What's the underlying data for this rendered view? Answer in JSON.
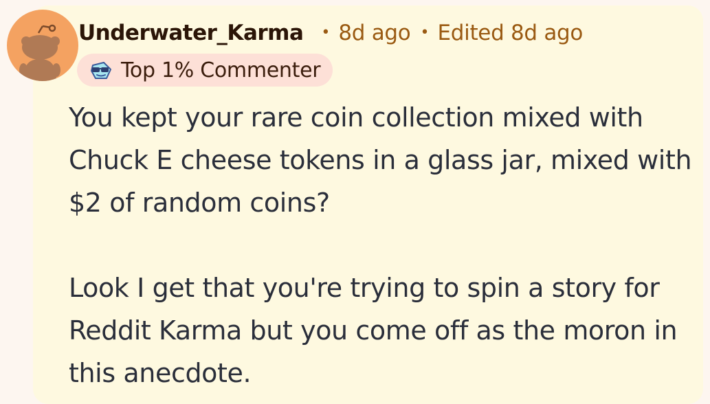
{
  "comment": {
    "author": "Underwater_Karma",
    "separator": "•",
    "posted_time": "8d ago",
    "edited_label": "Edited 8d ago",
    "badge": {
      "icon": "sunglasses-achievement-icon",
      "label": "Top 1% Commenter"
    },
    "paragraphs": [
      "You kept your rare coin collection mixed with Chuck E cheese tokens in a glass jar, mixed with $2 of random coins?",
      "Look I get that you're trying to spin a story for Reddit Karma but you come off as the moron in this anecdote."
    ]
  },
  "colors": {
    "page_background": "#fdf6f0",
    "card_background": "#fef9e0",
    "avatar_orange": "#f4a261",
    "username": "#2b1507",
    "meta_text": "#9a5a12",
    "badge_background": "#fde0d7",
    "body_text": "#2a2e3a"
  }
}
